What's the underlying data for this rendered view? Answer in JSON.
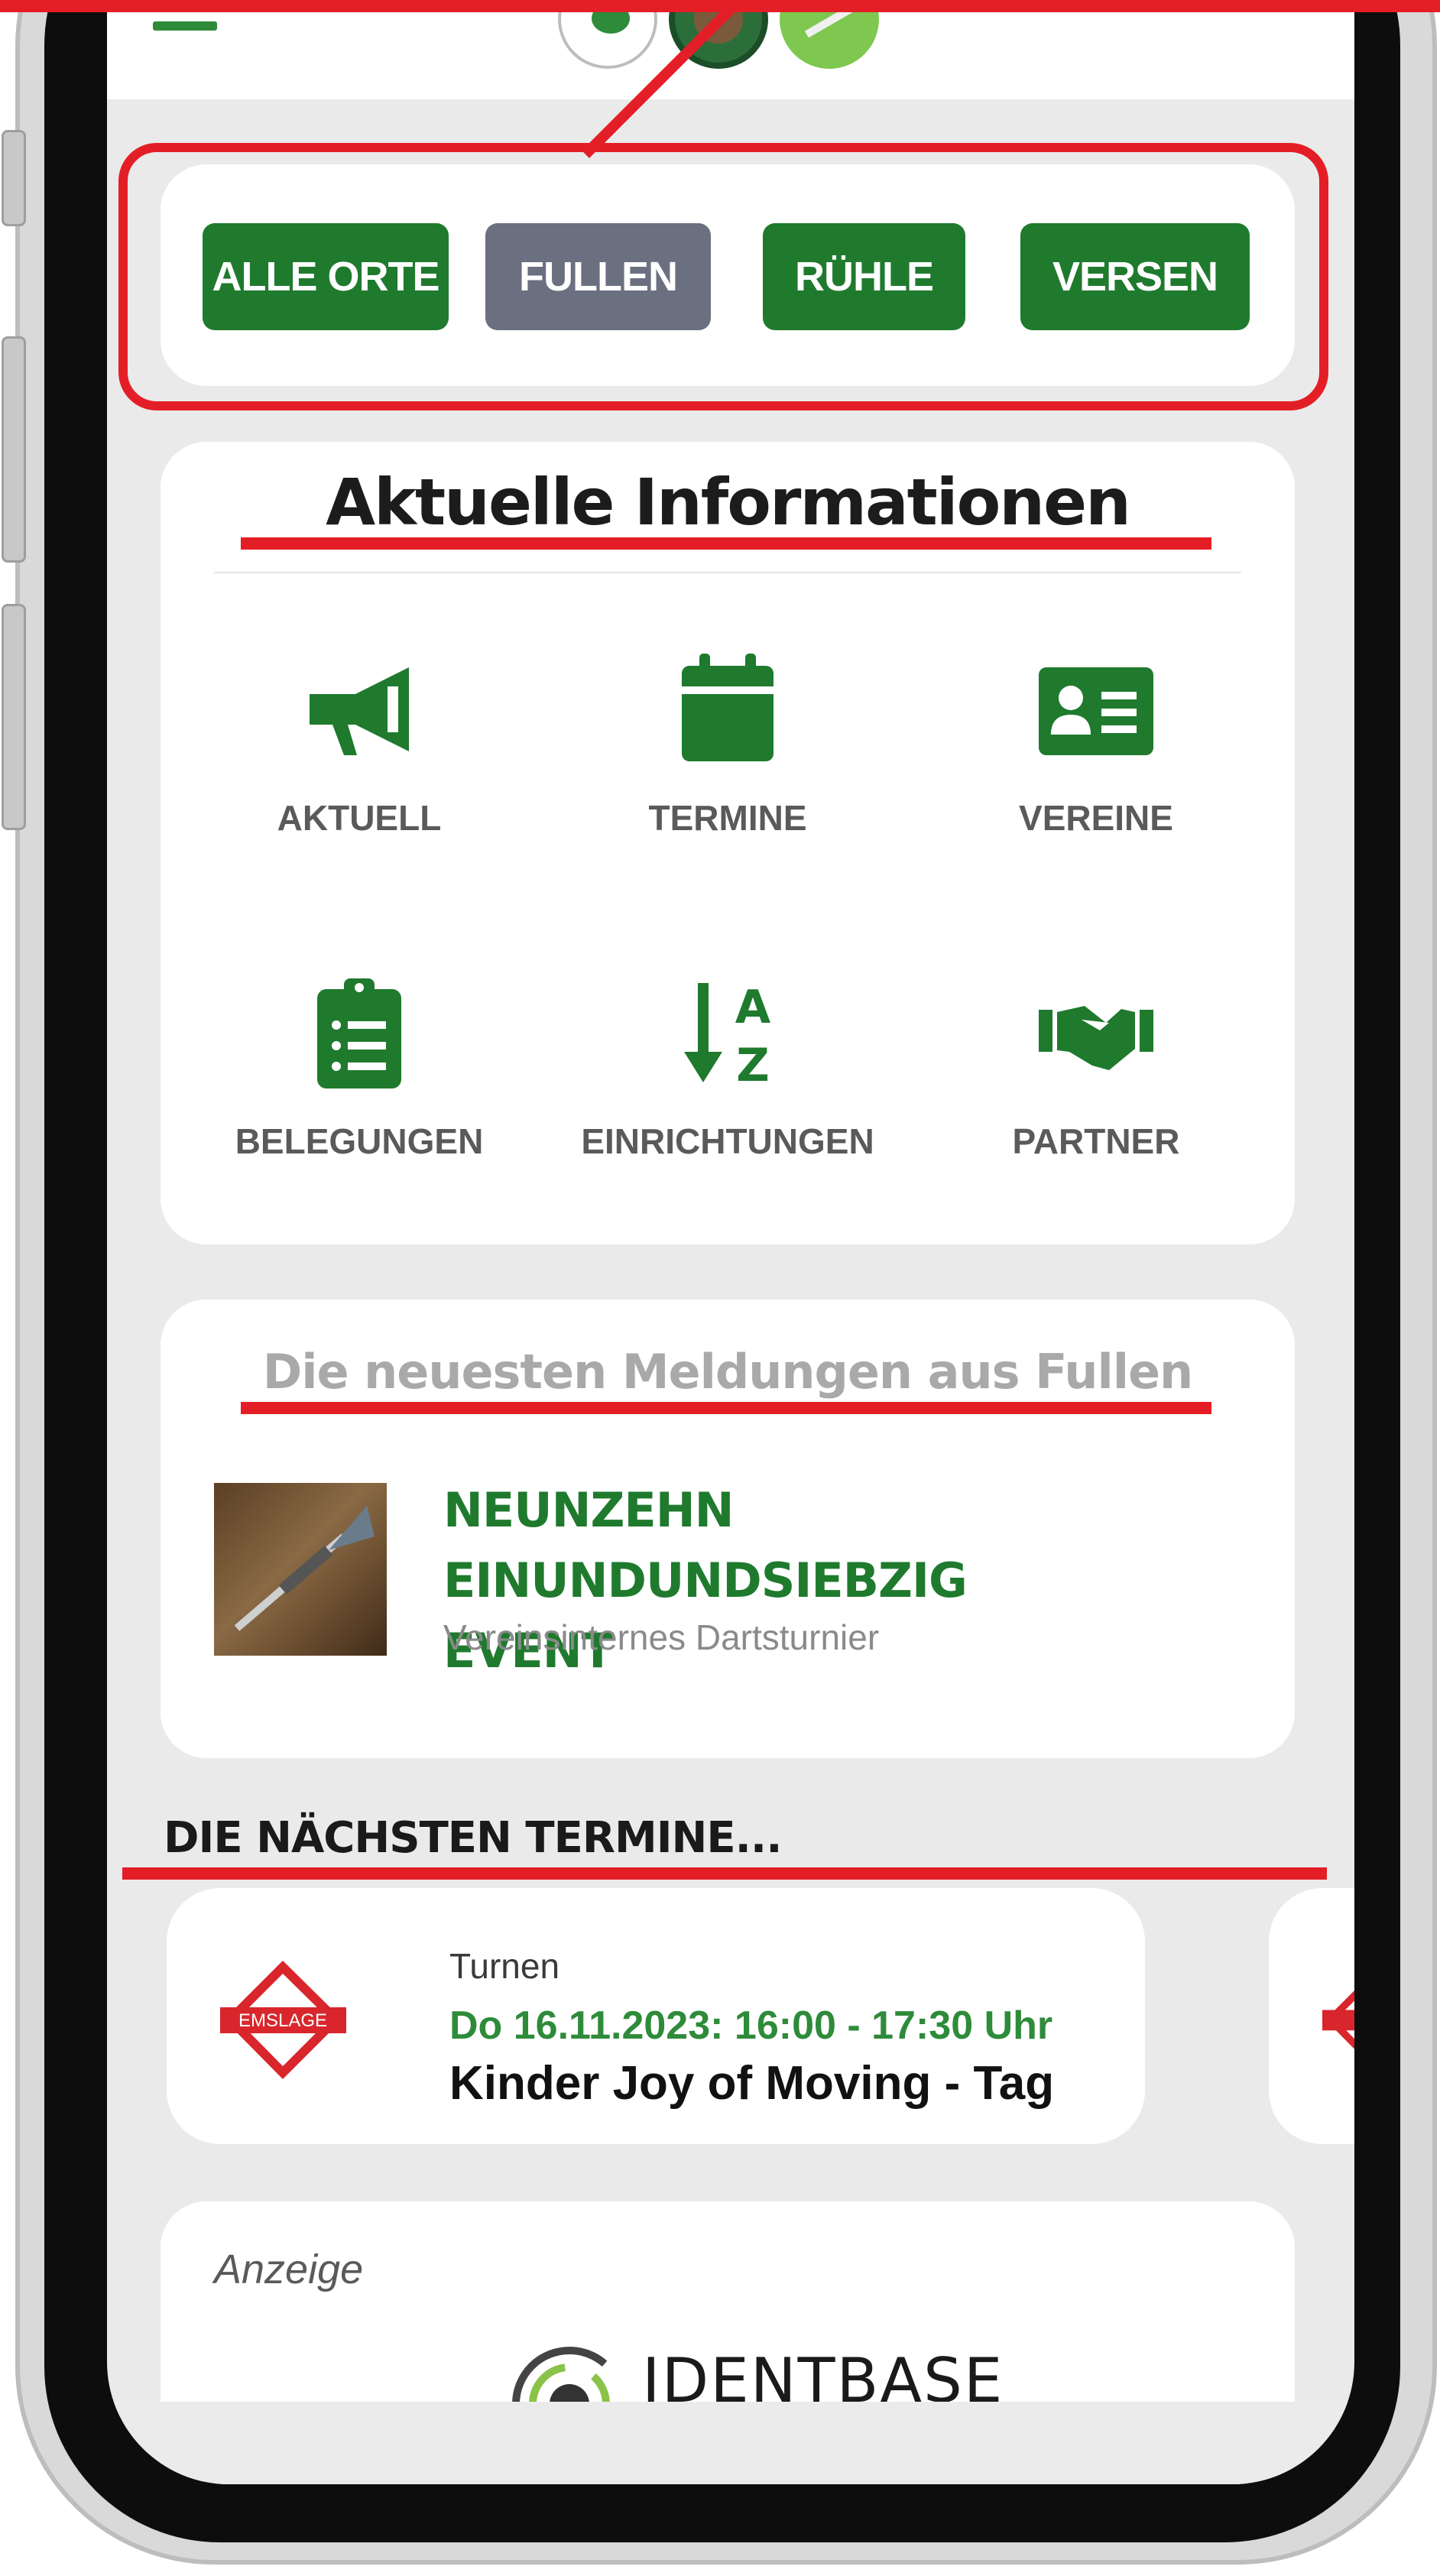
{
  "filter": {
    "buttons": [
      {
        "label": "ALLE ORTE",
        "state": "active"
      },
      {
        "label": "FULLEN",
        "state": "selected"
      },
      {
        "label": "RÜHLE",
        "state": "active"
      },
      {
        "label": "VERSEN",
        "state": "active"
      }
    ]
  },
  "info": {
    "title": "Aktuelle Informationen",
    "tiles": [
      {
        "label": "AKTUELL",
        "icon": "megaphone-icon"
      },
      {
        "label": "TERMINE",
        "icon": "calendar-icon"
      },
      {
        "label": "VEREINE",
        "icon": "id-card-icon"
      },
      {
        "label": "BELEGUNGEN",
        "icon": "clipboard-list-icon"
      },
      {
        "label": "EINRICHTUNGEN",
        "icon": "sort-alpha-icon"
      },
      {
        "label": "PARTNER",
        "icon": "handshake-icon"
      }
    ]
  },
  "news": {
    "heading": "Die neuesten Meldungen aus Fullen",
    "items": [
      {
        "title_line1": "NEUNZEHN EINUNDUNDSIEBZIG",
        "title_line2": "EVENT",
        "subtitle": "Vereinsinternes Dartsturnier"
      }
    ]
  },
  "events": {
    "section_title": "DIE NÄCHSTEN TERMINE...",
    "items": [
      {
        "category": "Turnen",
        "date": "Do 16.11.2023: 16:00 - 17:30 Uhr",
        "title": "Kinder Joy of Moving - Tag",
        "logo_text": "EMSLAGE"
      }
    ]
  },
  "ad": {
    "label": "Anzeige",
    "brand": "IDENTBASE"
  },
  "colors": {
    "brand_green": "#1f7a2e",
    "selected_gray": "#6b7080",
    "annotation_red": "#e41e26"
  }
}
